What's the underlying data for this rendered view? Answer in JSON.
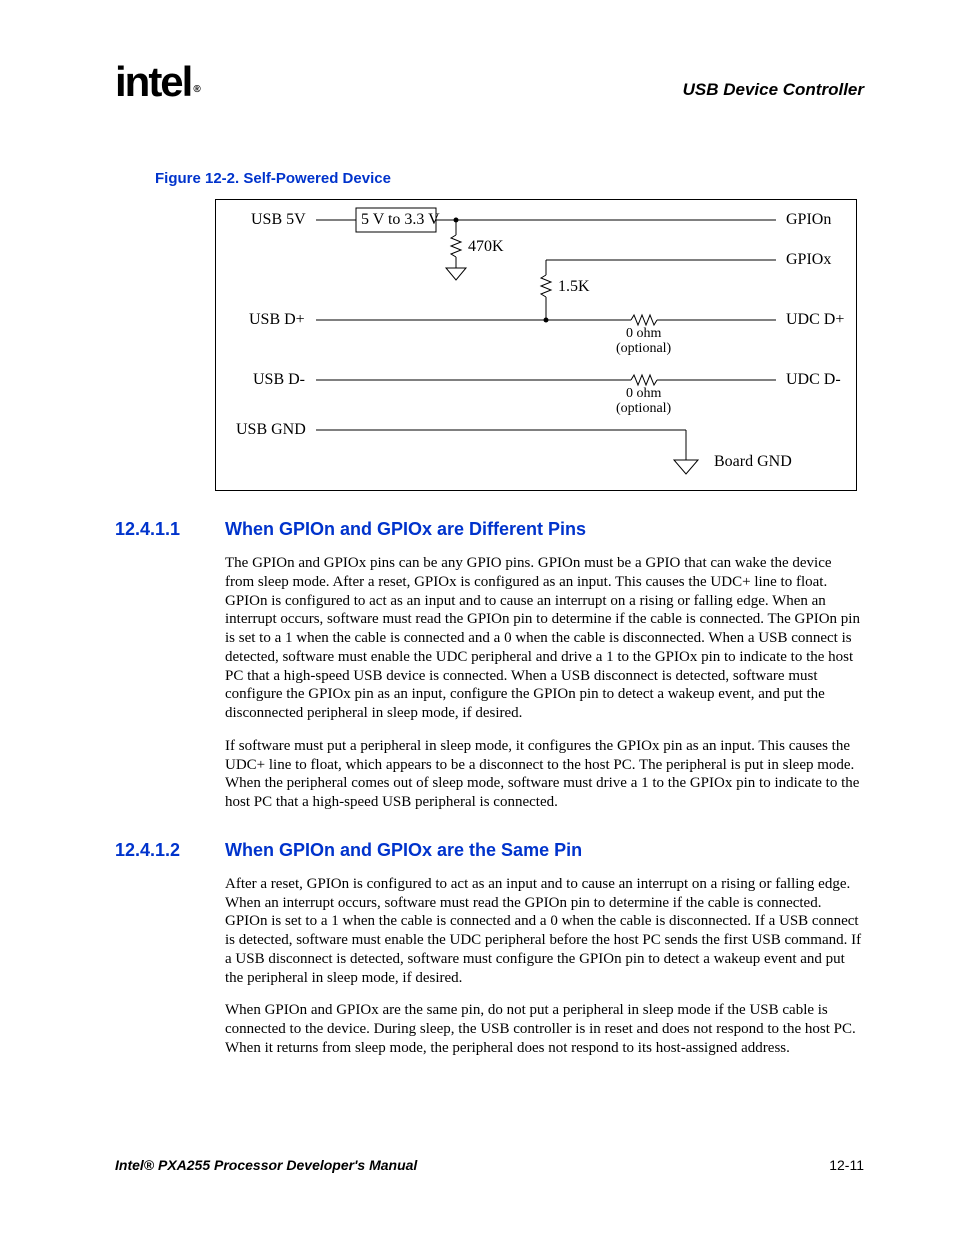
{
  "header": {
    "logo": "intel",
    "logo_reg": "®",
    "chapter": "USB Device Controller"
  },
  "figure": {
    "caption": "Figure 12-2. Self-Powered Device",
    "labels": {
      "usb5v": "USB 5V",
      "usbdp": "USB D+",
      "usbdm": "USB D-",
      "usbgnd": "USB GND",
      "gpion": "GPIOn",
      "gpiox": "GPIOx",
      "udcdp": "UDC D+",
      "udcdm": "UDC D-",
      "boardgnd": "Board GND",
      "reg": "5 V to 3.3 V",
      "r470k": "470K",
      "r15k": "1.5K",
      "ohm0a": "0 ohm",
      "opta": "(optional)",
      "ohm0b": "0 ohm",
      "optb": "(optional)"
    }
  },
  "sections": [
    {
      "number": "12.4.1.1",
      "title": "When GPIOn and GPIOx are Different Pins",
      "paragraphs": [
        "The GPIOn and GPIOx pins can be any GPIO pins. GPIOn must be a GPIO that can wake the device from sleep mode. After a reset, GPIOx is configured as an input. This causes the UDC+ line to float. GPIOn is configured to act as an input and to cause an interrupt on a rising or falling edge. When an interrupt occurs, software must read the GPIOn pin to determine if the cable is connected. The GPIOn pin is set to a 1 when the cable is connected and a 0 when the cable is disconnected. When a USB connect is detected, software must enable the UDC peripheral and drive a 1 to the GPIOx pin to indicate to the host PC that a high-speed USB device is connected. When a USB disconnect is detected, software must configure the GPIOx pin as an input, configure the GPIOn pin to detect a wakeup event, and put the disconnected peripheral in sleep mode, if desired.",
        "If software must put a peripheral in sleep mode, it configures the GPIOx pin as an input. This causes the UDC+ line to float, which appears to be a disconnect to the host PC. The peripheral is put in sleep mode. When the peripheral comes out of sleep mode, software must drive a 1 to the GPIOx pin to indicate to the host PC that a high-speed USB peripheral is connected."
      ]
    },
    {
      "number": "12.4.1.2",
      "title": "When GPIOn and GPIOx are the Same Pin",
      "paragraphs": [
        "After a reset, GPIOn is configured to act as an input and to cause an interrupt on a rising or falling edge. When an interrupt occurs, software must read the GPIOn pin to determine if the cable is connected. GPIOn is set to a 1 when the cable is connected and a 0 when the cable is disconnected. If a USB connect is detected, software must enable the UDC peripheral before the host PC sends the first USB command. If a USB disconnect is detected, software must configure the GPIOn pin to detect a wakeup event and put the peripheral in sleep mode, if desired.",
        "When GPIOn and GPIOx are the same pin, do not put a peripheral in sleep mode if the USB cable is connected to the device. During sleep, the USB controller is in reset and does not respond to the host PC. When it returns from sleep mode, the peripheral does not respond to its host-assigned address."
      ]
    }
  ],
  "footer": {
    "left": "Intel® PXA255 Processor Developer's Manual",
    "right": "12-11"
  }
}
